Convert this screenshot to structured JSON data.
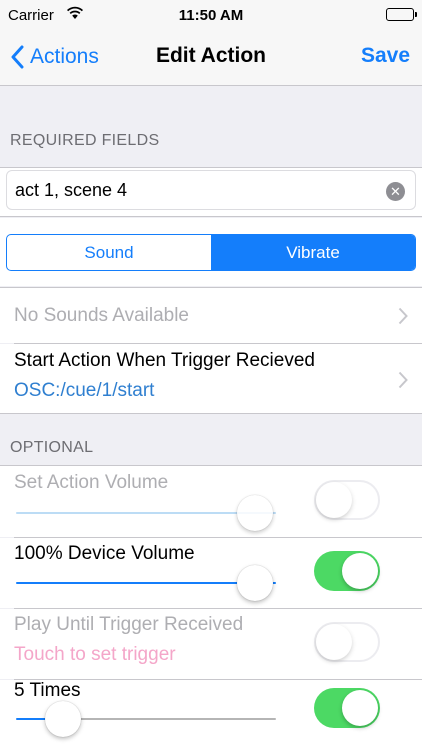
{
  "status_bar": {
    "carrier": "Carrier",
    "time": "11:50 AM"
  },
  "nav": {
    "back_label": "Actions",
    "title": "Edit Action",
    "save_label": "Save"
  },
  "sections": {
    "required": "REQUIRED FIELDS",
    "optional": "OPTIONAL"
  },
  "name_field": {
    "value": "act 1, scene 4"
  },
  "alert_type": {
    "options": [
      "Sound",
      "Vibrate"
    ],
    "selected": "Vibrate"
  },
  "sound_row": {
    "label": "No Sounds Available"
  },
  "trigger_row": {
    "title": "Start Action When Trigger Recieved",
    "value": "OSC:/cue/1/start"
  },
  "action_volume": {
    "label": "Set Action Volume",
    "slider_value": 0.92,
    "enabled": false
  },
  "device_volume": {
    "label": "100% Device Volume",
    "slider_value": 0.92,
    "enabled": true
  },
  "play_until": {
    "label": "Play Until Trigger Received",
    "hint": "Touch to set trigger",
    "enabled": false
  },
  "repeat": {
    "label": "5 Times",
    "slider_value": 0.18,
    "enabled": true
  },
  "colors": {
    "accent": "#147efb",
    "toggle_on": "#4cd964",
    "disabled_text": "#aeaeb2",
    "hint_pink": "#f4a6c9",
    "trigger_value": "#2f7fd0"
  }
}
